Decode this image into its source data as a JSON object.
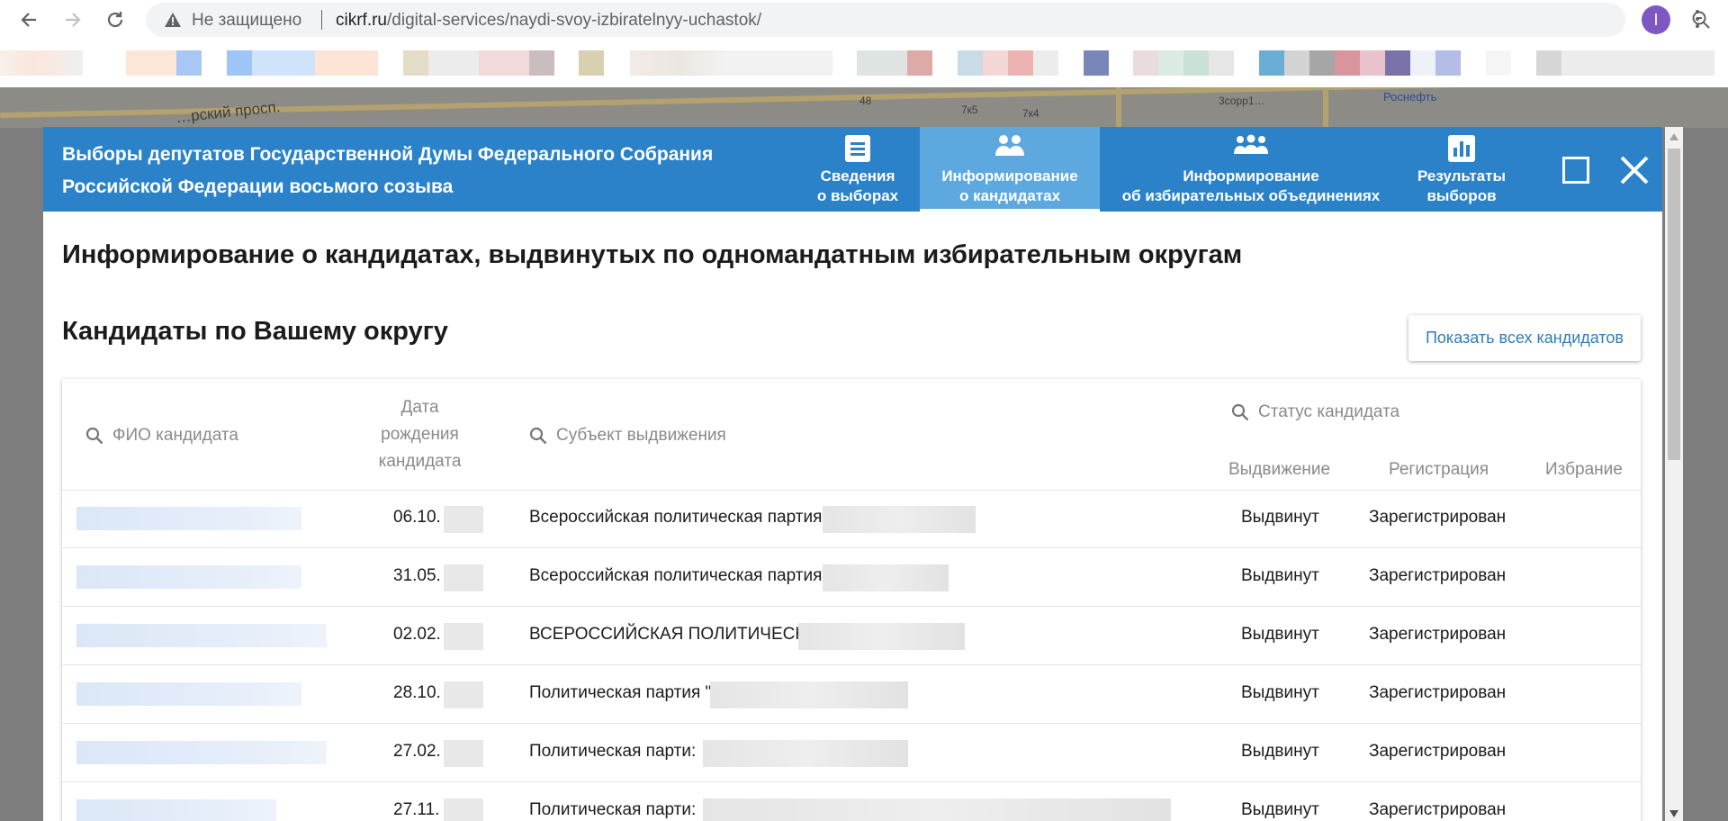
{
  "browser": {
    "security_label": "Не защищено",
    "url_host": "cikrf.ru",
    "url_path": "/digital-services/naydi-svoy-izbiratelnyy-uchastok/",
    "profile_initial": "I"
  },
  "map": {
    "street": "…рский просп.",
    "labels": [
      "48",
      "7к5",
      "7к4",
      "3сорр1…",
      "Роснефть"
    ]
  },
  "modal": {
    "title_line1": "Выборы депутатов Государственной Думы Федерального Собрания",
    "title_line2": "Российской Федерации восьмого созыва",
    "tabs": [
      {
        "line1": "Сведения",
        "line2": "о выборах",
        "icon": "document-icon"
      },
      {
        "line1": "Информирование",
        "line2": "о кандидатах",
        "icon": "people-icon",
        "active": true
      },
      {
        "line1": "Информирование",
        "line2": "об избирательных объединениях",
        "icon": "group-icon"
      },
      {
        "line1": "Результаты",
        "line2": "выборов",
        "icon": "bar-chart-icon"
      }
    ],
    "heading": "Информирование о кандидатах, выдвинутых по одномандатным избирательным округам",
    "subheading": "Кандидаты по Вашему округу",
    "show_all_button": "Показать всех кандидатов"
  },
  "table": {
    "fio_placeholder": "ФИО кандидата",
    "date_header_line1": "Дата",
    "date_header_line2": "рождения",
    "date_header_line3": "кандидата",
    "subject_placeholder": "Субъект выдвижения",
    "status_placeholder": "Статус кандидата",
    "col_nomination": "Выдвижение",
    "col_registration": "Регистрация",
    "col_election": "Избрание",
    "rows": [
      {
        "date": "06.10.",
        "subject": "Всероссийская политическая партия",
        "nomination": "Выдвинут",
        "registration": "Зарегистрирован"
      },
      {
        "date": "31.05.",
        "subject": "Всероссийская политическая партия",
        "nomination": "Выдвинут",
        "registration": "Зарегистрирован"
      },
      {
        "date": "02.02.",
        "subject": "ВСЕРОССИЙСКАЯ ПОЛИТИЧЕСКА",
        "nomination": "Выдвинут",
        "registration": "Зарегистрирован"
      },
      {
        "date": "28.10.",
        "subject": "Политическая партия \"",
        "nomination": "Выдвинут",
        "registration": "Зарегистрирован"
      },
      {
        "date": "27.02.",
        "subject": "Политическая парти:",
        "nomination": "Выдвинут",
        "registration": "Зарегистрирован"
      },
      {
        "date": "27.11.",
        "subject": "Политическая парти:",
        "nomination": "Выдвинут",
        "registration": "Зарегистрирован"
      }
    ]
  }
}
